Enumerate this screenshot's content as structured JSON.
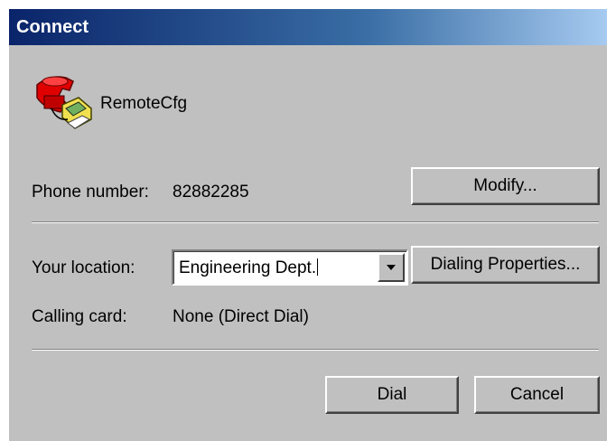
{
  "window": {
    "title": "Connect"
  },
  "connection": {
    "name": "RemoteCfg"
  },
  "phone": {
    "label": "Phone number:",
    "value": "82882285",
    "modify_button": "Modify..."
  },
  "location": {
    "label": "Your location:",
    "selected": "Engineering Dept.",
    "dialing_properties_button": "Dialing Properties..."
  },
  "calling_card": {
    "label": "Calling card:",
    "value": "None (Direct Dial)"
  },
  "actions": {
    "dial": "Dial",
    "cancel": "Cancel"
  },
  "icons": {
    "phone": "telephone-icon",
    "dropdown": "chevron-down-icon"
  }
}
